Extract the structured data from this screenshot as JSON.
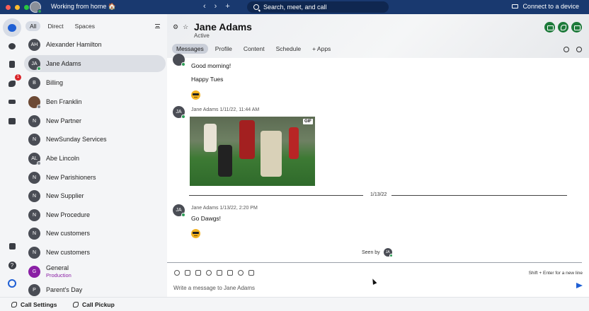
{
  "titlebar": {
    "status": "Working from home 🏠",
    "nav_back": "‹",
    "nav_forward": "›",
    "nav_new": "+",
    "search_placeholder": "Search, meet, and call",
    "connect_label": "Connect to a device"
  },
  "rail": {
    "calls_badge": "1",
    "help_glyph": "?"
  },
  "list": {
    "filters": [
      "All",
      "Direct",
      "Spaces"
    ],
    "contacts": [
      {
        "initials": "AH",
        "name": "Alexander Hamilton"
      },
      {
        "initials": "JA",
        "name": "Jane Adams"
      },
      {
        "initials": "B",
        "name": "Billing"
      },
      {
        "initials": "",
        "name": "Ben Franklin"
      },
      {
        "initials": "N",
        "name": "New Partner"
      },
      {
        "initials": "N",
        "name": "NewSunday Services"
      },
      {
        "initials": "AL",
        "name": "Abe Lincoln"
      },
      {
        "initials": "N",
        "name": "New Parishioners"
      },
      {
        "initials": "N",
        "name": "New Supplier"
      },
      {
        "initials": "N",
        "name": "New Procedure"
      },
      {
        "initials": "N",
        "name": "New customers"
      },
      {
        "initials": "N",
        "name": "New customers"
      },
      {
        "initials": "G",
        "name": "General",
        "sub": "Production"
      },
      {
        "initials": "P",
        "name": "Parent's Day"
      }
    ]
  },
  "bottom": {
    "call_settings": "Call Settings",
    "call_pickup": "Call Pickup"
  },
  "header": {
    "name": "Jane Adams",
    "status": "Active",
    "tabs": [
      "Messages",
      "Profile",
      "Content",
      "Schedule"
    ],
    "apps_label": "+ Apps"
  },
  "messages": {
    "m1_line1": "Good morning!",
    "m1_line2": "Happy Tues",
    "m2_initials": "JA",
    "m2_meta": "Jane Adams  1/11/22, 11:44 AM",
    "gif_badge": "GIF",
    "date_divider": "1/13/22",
    "m3_initials": "JA",
    "m3_meta": "Jane Adams  1/13/22, 2:20 PM",
    "m3_text": "Go Dawgs!",
    "seen_by": "Seen by",
    "seen_initials": "JA"
  },
  "composer": {
    "hint": "Shift + Enter for a new line",
    "placeholder": "Write a message to Jane Adams"
  },
  "colors": {
    "titlebar": "#19396f",
    "accent": "#1f5fd4",
    "call_green": "#1d7a3a",
    "presence": "#2e9d57",
    "badge_red": "#d9252a"
  }
}
